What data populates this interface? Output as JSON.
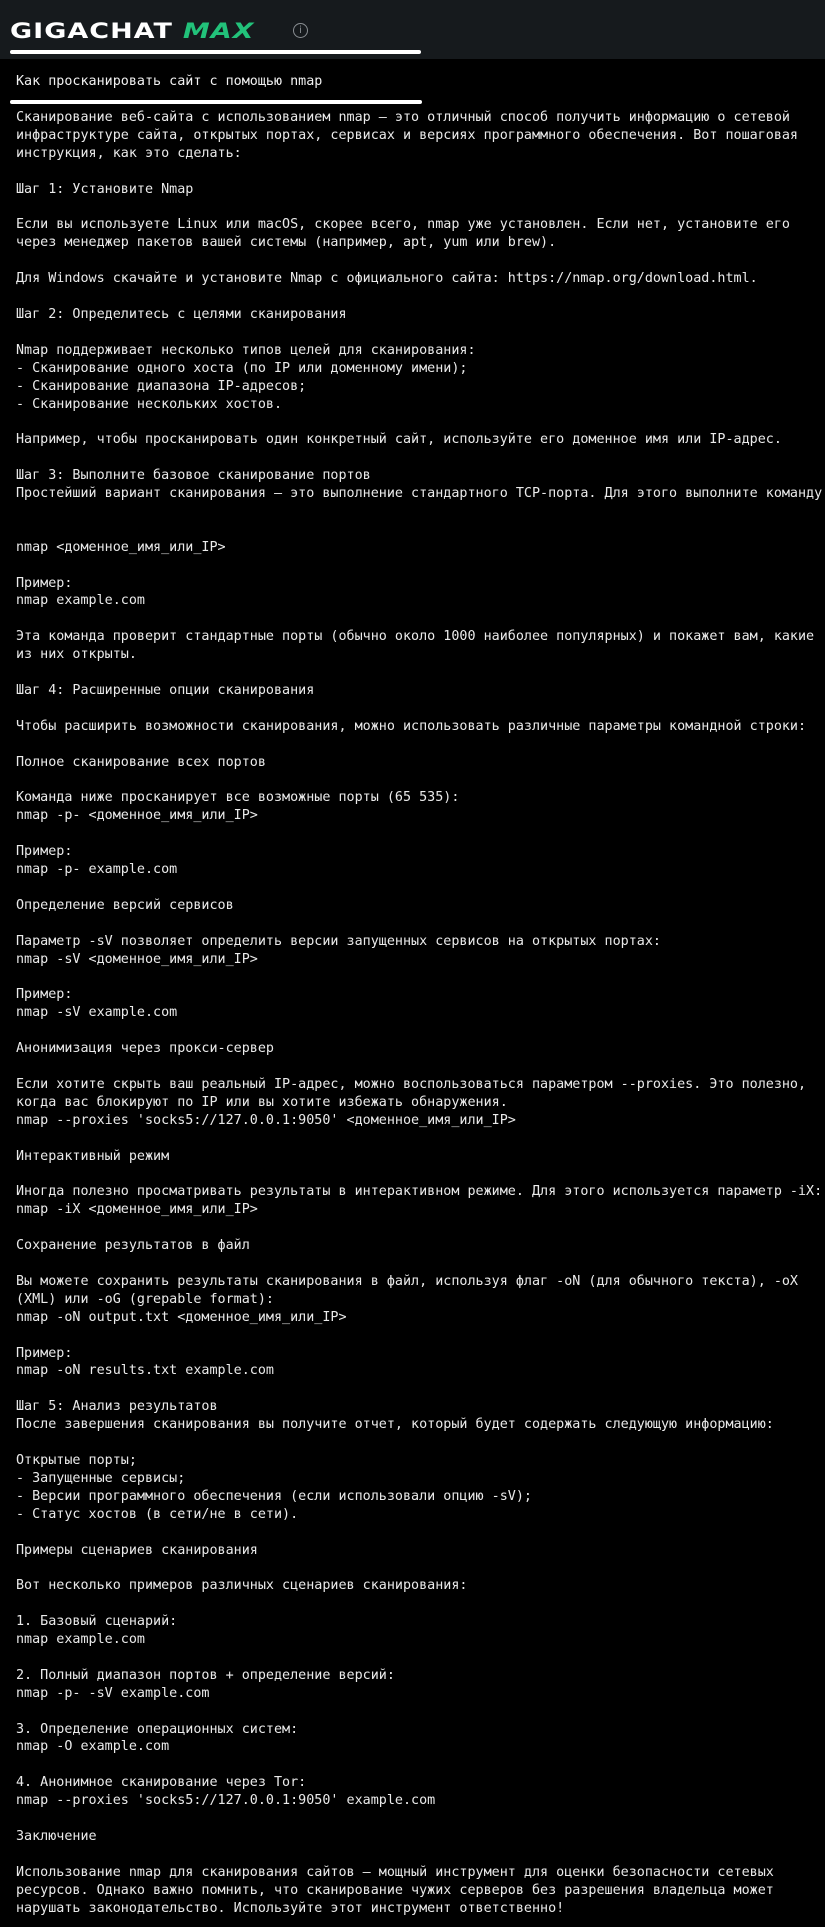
{
  "header": {
    "logo_text": "GIGACHAT",
    "logo_accent": "MAX",
    "info_icon": "info-icon",
    "info_glyph": "i",
    "accent_color": "#22c27a",
    "background_color": "#161a1d"
  },
  "question": {
    "text": "Как просканировать сайт с помощью nmap"
  },
  "answer": {
    "text": "Сканирование веб-сайта с использованием nmap — это отличный способ получить информацию о сетевой\nинфраструктуре сайта, открытых портах, сервисах и версиях программного обеспечения. Вот пошаговая\nинструкция, как это сделать:\n\nШаг 1: Установите Nmap\n\nЕсли вы используете Linux или macOS, скорее всего, nmap уже установлен. Если нет, установите его\nчерез менеджер пакетов вашей системы (например, apt, yum или brew).\n\nДля Windows скачайте и установите Nmap с официального сайта: https://nmap.org/download.html.\n\nШаг 2: Определитесь с целями сканирования\n\nNmap поддерживает несколько типов целей для сканирования:\n- Сканирование одного хоста (по IP или доменному имени);\n- Сканирование диапазона IP-адресов;\n- Сканирование нескольких хостов.\n\nНапример, чтобы просканировать один конкретный сайт, используйте его доменное имя или IP-адрес.\n\nШаг 3: Выполните базовое сканирование портов\nПростейший вариант сканирования — это выполнение стандартного TCP-порта. Для этого выполните команду:\n\n\nnmap <доменное_имя_или_IP>\n\nПример:\nnmap example.com\n\nЭта команда проверит стандартные порты (обычно около 1000 наиболее популярных) и покажет вам, какие\nиз них открыты.\n\nШаг 4: Расширенные опции сканирования\n\nЧтобы расширить возможности сканирования, можно использовать различные параметры командной строки:\n\nПолное сканирование всех портов\n\nКоманда ниже просканирует все возможные порты (65 535):\nnmap -p- <доменное_имя_или_IP>\n\nПример:\nnmap -p- example.com\n\nОпределение версий сервисов\n\nПараметр -sV позволяет определить версии запущенных сервисов на открытых портах:\nnmap -sV <доменное_имя_или_IP>\n\nПример:\nnmap -sV example.com\n\nАнонимизация через прокси-сервер\n\nЕсли хотите скрыть ваш реальный IP-адрес, можно воспользоваться параметром --proxies. Это полезно,\nкогда вас блокируют по IP или вы хотите избежать обнаружения.\nnmap --proxies 'socks5://127.0.0.1:9050' <доменное_имя_или_IP>\n\nИнтерактивный режим\n\nИногда полезно просматривать результаты в интерактивном режиме. Для этого используется параметр -iX:\nnmap -iX <доменное_имя_или_IP>\n\nСохранение результатов в файл\n\nВы можете сохранить результаты сканирования в файл, используя флаг -oN (для обычного текста), -oX\n(XML) или -oG (grepable format):\nnmap -oN output.txt <доменное_имя_или_IP>\n\nПример:\nnmap -oN results.txt example.com\n\nШаг 5: Анализ результатов\nПосле завершения сканирования вы получите отчет, который будет содержать следующую информацию:\n\nОткрытые порты;\n- Запущенные сервисы;\n- Версии программного обеспечения (если использовали опцию -sV);\n- Статус хостов (в сети/не в сети).\n\nПримеры сценариев сканирования\n\nВот несколько примеров различных сценариев сканирования:\n\n1. Базовый сценарий:\nnmap example.com\n\n2. Полный диапазон портов + определение версий:\nnmap -p- -sV example.com\n\n3. Определение операционных систем:\nnmap -O example.com\n\n4. Анонимное сканирование через Tor:\nnmap --proxies 'socks5://127.0.0.1:9050' example.com\n\nЗаключение\n\nИспользование nmap для сканирования сайтов — мощный инструмент для оценки безопасности сетевых\nресурсов. Однако важно помнить, что сканирование чужих серверов без разрешения владельца может\nнарушать законодательство. Используйте этот инструмент ответственно!"
  }
}
